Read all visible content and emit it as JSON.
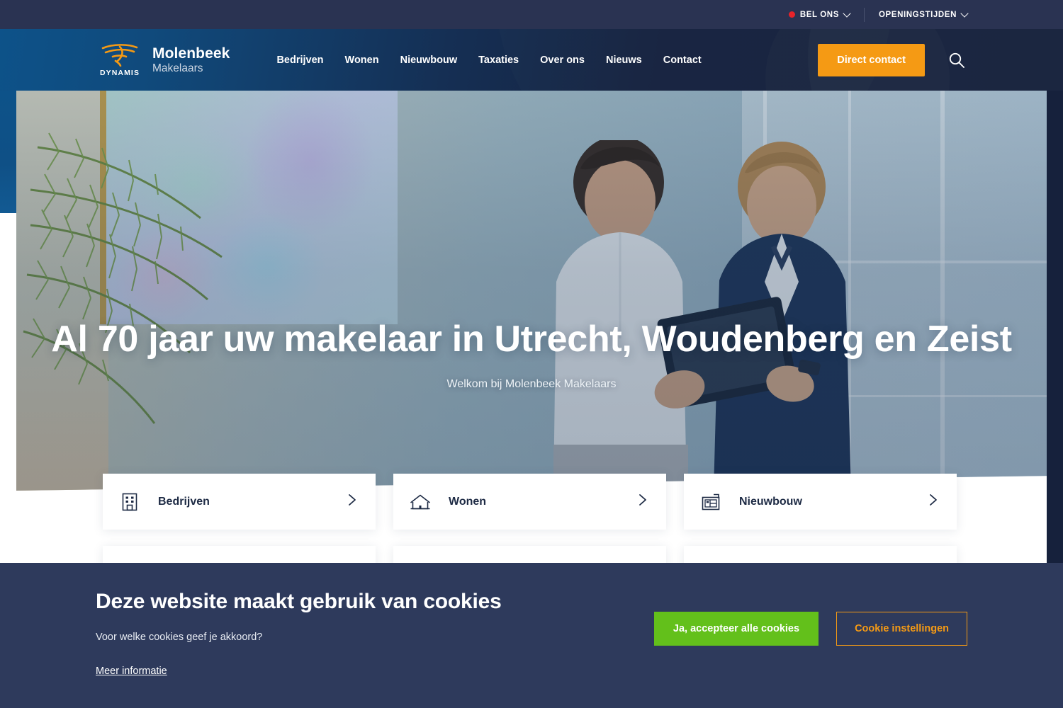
{
  "topbar": {
    "call_label": "BEL ONS",
    "hours_label": "OPENINGSTIJDEN"
  },
  "header": {
    "logo": {
      "dynamis": "DYNAMIS",
      "name": "Molenbeek",
      "subtitle": "Makelaars",
      "mark_icon": "dynamis-swoosh-icon"
    },
    "nav": [
      {
        "label": "Bedrijven"
      },
      {
        "label": "Wonen"
      },
      {
        "label": "Nieuwbouw"
      },
      {
        "label": "Taxaties"
      },
      {
        "label": "Over ons"
      },
      {
        "label": "Nieuws"
      },
      {
        "label": "Contact"
      }
    ],
    "cta_label": "Direct contact",
    "search_icon": "search-icon",
    "cta_color": "#F59A14"
  },
  "hero": {
    "title": "Al 70 jaar uw makelaar in Utrecht, Woudenberg en Zeist",
    "subtitle": "Welkom bij Molenbeek Makelaars"
  },
  "cards": [
    {
      "label": "Bedrijven",
      "icon": "office-building-icon",
      "arrow": "chevron-right-icon"
    },
    {
      "label": "Wonen",
      "icon": "house-icon",
      "arrow": "chevron-right-icon"
    },
    {
      "label": "Nieuwbouw",
      "icon": "floorplan-icon",
      "arrow": "chevron-right-icon"
    }
  ],
  "cookie": {
    "title": "Deze website maakt gebruik van cookies",
    "question": "Voor welke cookies geef je akkoord?",
    "more_info": "Meer informatie",
    "accept_label": "Ja, accepteer alle cookies",
    "settings_label": "Cookie instellingen",
    "accept_color": "#63C01B",
    "settings_color": "#F59A14",
    "background": "#2E3A5C"
  }
}
